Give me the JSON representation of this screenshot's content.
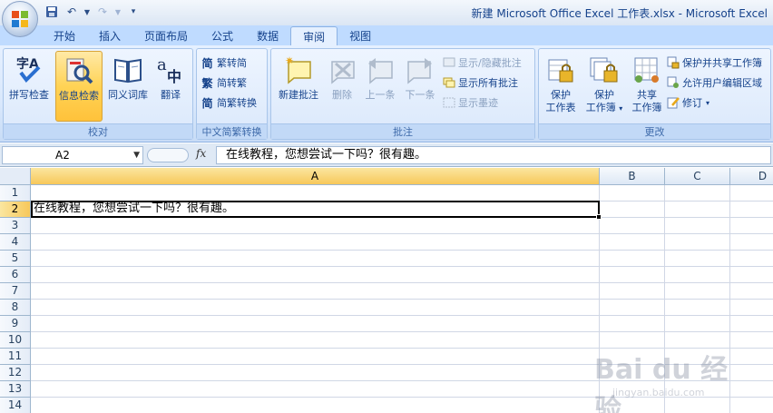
{
  "window": {
    "title": "新建 Microsoft Office Excel 工作表.xlsx - Microsoft Excel"
  },
  "tabs": [
    {
      "label": "开始"
    },
    {
      "label": "插入"
    },
    {
      "label": "页面布局"
    },
    {
      "label": "公式"
    },
    {
      "label": "数据"
    },
    {
      "label": "审阅",
      "active": true
    },
    {
      "label": "视图"
    }
  ],
  "ribbon": {
    "proofing": {
      "label": "校对",
      "spell": "拼写检查",
      "research": "信息检索",
      "thesaurus": "同义词库",
      "translate": "翻译"
    },
    "chinese": {
      "label": "中文简繁转换",
      "to_simplified": "繁转简",
      "to_traditional": "简转繁",
      "convert": "简繁转换"
    },
    "comments": {
      "label": "批注",
      "new": "新建批注",
      "delete": "删除",
      "prev": "上一条",
      "next": "下一条",
      "show_hide": "显示/隐藏批注",
      "show_all": "显示所有批注",
      "show_ink": "显示墨迹"
    },
    "changes": {
      "label": "更改",
      "protect_sheet_1": "保护",
      "protect_sheet_2": "工作表",
      "protect_wb_1": "保护",
      "protect_wb_2": "工作簿",
      "share_wb_1": "共享",
      "share_wb_2": "工作簿",
      "protect_share": "保护并共享工作簿",
      "allow_edit": "允许用户编辑区域",
      "track": "修订"
    }
  },
  "formula_bar": {
    "name_box": "A2",
    "fx": "fx",
    "content": "在线教程，您想尝试一下吗？很有趣。"
  },
  "sheet": {
    "columns": [
      "A",
      "B",
      "C",
      "D"
    ],
    "rows": [
      "1",
      "2",
      "3",
      "4",
      "5",
      "6",
      "7",
      "8",
      "9",
      "10",
      "11",
      "12",
      "13",
      "14"
    ],
    "cell_a2": "在线教程，您想尝试一下吗？很有趣。"
  },
  "watermark": {
    "brand": "Bai du 经验",
    "url": "jingyan.baidu.com"
  }
}
